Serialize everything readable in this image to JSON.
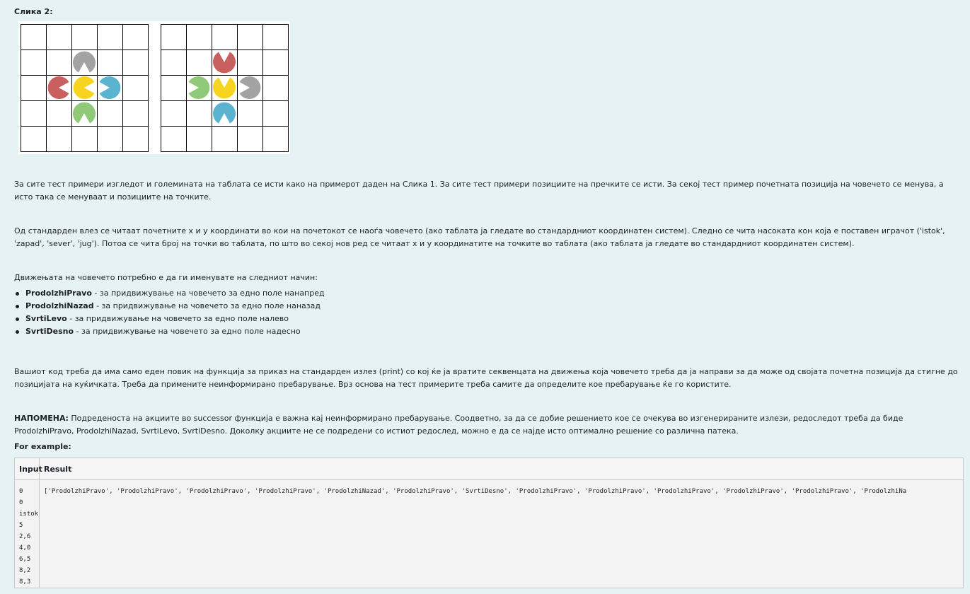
{
  "heading": "Слика 2:",
  "colors": {
    "gray": "#a3a3a3",
    "red": "#c95f5f",
    "yellow": "#f7d420",
    "blue": "#5ab4cf",
    "green": "#91c97b"
  },
  "figure_left": {
    "pieces": [
      {
        "name": "gray-pacman-icon",
        "color": "gray",
        "facing": "down"
      },
      {
        "name": "red-pacman-icon",
        "color": "red",
        "facing": "right"
      },
      {
        "name": "yellow-pacman-icon",
        "color": "yellow",
        "facing": "right"
      },
      {
        "name": "blue-pacman-icon",
        "color": "blue",
        "facing": "left"
      },
      {
        "name": "green-pacman-icon",
        "color": "green",
        "facing": "down"
      }
    ]
  },
  "figure_right": {
    "pieces": [
      {
        "name": "red-pacman-icon",
        "color": "red",
        "facing": "up"
      },
      {
        "name": "green-pacman-icon",
        "color": "green",
        "facing": "left"
      },
      {
        "name": "yellow-pacman-icon",
        "color": "yellow",
        "facing": "up"
      },
      {
        "name": "gray-pacman-icon",
        "color": "gray",
        "facing": "left"
      },
      {
        "name": "blue-pacman-icon",
        "color": "blue",
        "facing": "down"
      }
    ]
  },
  "paragraphs": {
    "p1": "За сите тест примери изгледот и големината на таблата се исти како на примерот даден на Слика 1. За сите тест примери позициите на пречките се исти. За секој тест пример почетната позиција на човечето се менува, а исто така се менуваат и позициите на точките.",
    "p2": "Од стандарден влез се читаат почетните x и y координати во кои на почетокот се наоѓа човечето (ако таблата ја гледате во стандардниот координатен систем). Следно се чита насоката кон која е поставен играчот ('istok', 'zapad', 'sever', 'jug'). Потоа се чита број на точки во таблата, по што во секој нов ред се читаат x и y координатите на точките во таблата (ако таблата ја гледате во стандардниот координатен систем).",
    "p3": "Движењата на човечето потребно е да ги именувате на следниот начин:",
    "p4": "Вашиот код треба да има само еден повик на функција за приказ на стандарден излез (print) со кој ќе ја вратите секвенцата на движења која човечето треба да ја направи за да може од својата почетна позиција да стигне до позицијата на куќичката. Треба да примените неинформирано пребарување. Врз основа на тест примерите треба самите да определите кое пребарување ќе го користите.",
    "p5_label": "НАПОМЕНА:",
    "p5_text": " Подреденоста на акциите во successor функција е важна кај неинформирано пребарување. Соодветно, за да се добие решението кое се очекува во изгенерираните излези, редоследот треба да биде ProdolzhiPravo, ProdolzhiNazad, SvrtiLevo, SvrtiDesno. Доколку акциите не се подредени со истиот редослед, можно е да се најде исто оптимално решение со различна патека."
  },
  "moves": [
    {
      "name": "ProdolzhiPravo",
      "desc": " - за придвижување на човечето за едно поле нанапред"
    },
    {
      "name": "ProdolzhiNazad",
      "desc": " - за придвижување на човечето за едно поле наназад"
    },
    {
      "name": "SvrtiLevo",
      "desc": " - за придвижување на човечето за едно поле налево"
    },
    {
      "name": "SvrtiDesno",
      "desc": " - за придвижување на човечето за едно поле надесно"
    }
  ],
  "example": {
    "label": "For example:",
    "header_input": "Input",
    "header_result": "Result",
    "input": "0\n0\nistok\n5\n2,6\n4,0\n6,5\n8,2\n8,3",
    "result": "['ProdolzhiPravo', 'ProdolzhiPravo', 'ProdolzhiPravo', 'ProdolzhiPravo', 'ProdolzhiNazad', 'ProdolzhiPravo', 'SvrtiDesno', 'ProdolzhiPravo', 'ProdolzhiPravo', 'ProdolzhiPravo', 'ProdolzhiPravo', 'ProdolzhiPravo', 'ProdolzhiNa"
  }
}
